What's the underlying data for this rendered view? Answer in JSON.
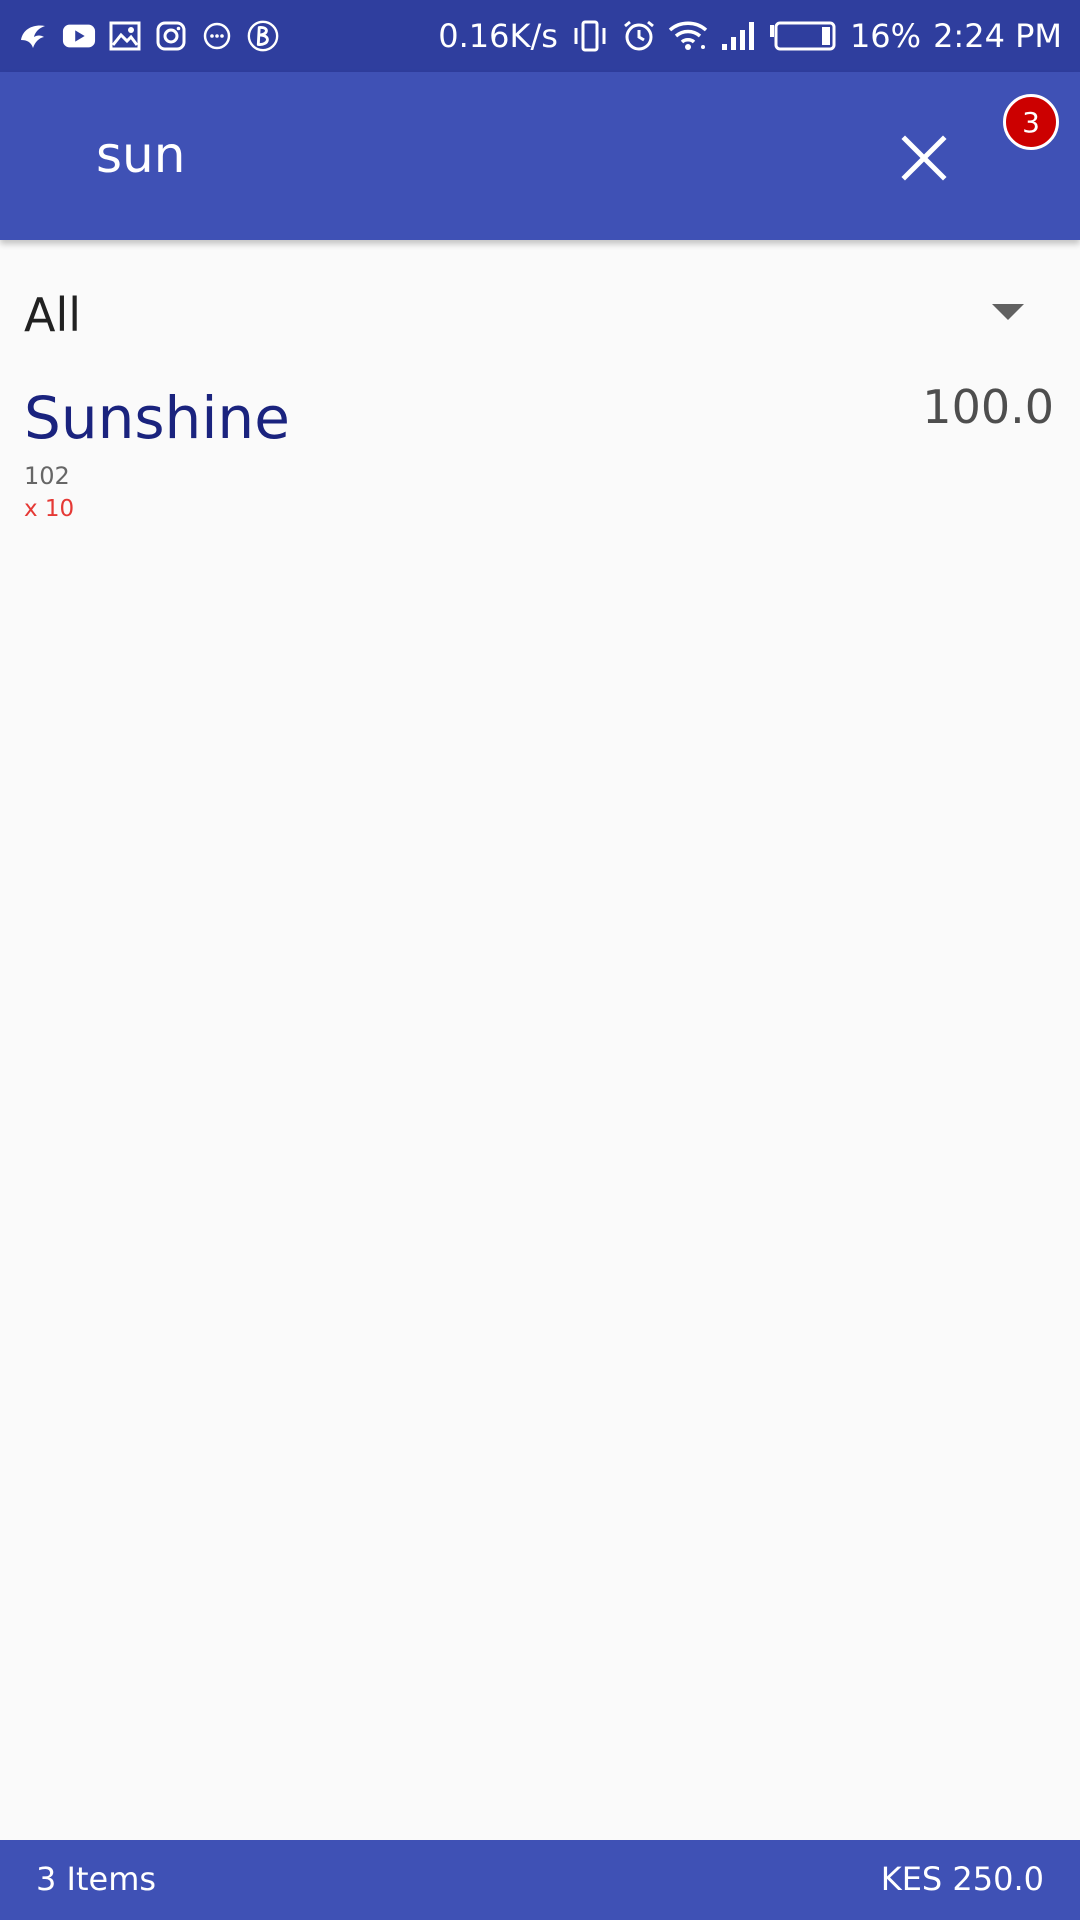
{
  "status_bar": {
    "network_speed": "0.16K/s",
    "battery_percent": "16%",
    "time": "2:24 PM",
    "left_icons": [
      "bird-app-icon",
      "youtube-icon",
      "gallery-icon",
      "instagram-icon",
      "chat-bubble-icon",
      "b-circle-icon"
    ],
    "right_icons": [
      "vibrate-icon",
      "alarm-icon",
      "wifi-icon",
      "signal-icon",
      "battery-icon"
    ]
  },
  "app_bar": {
    "search_query": "sun",
    "close_icon": "close-icon",
    "cart_count": "3",
    "colors": {
      "status_bar": "#2F3E9E",
      "primary": "#3F51B5",
      "badge": "#CC0000"
    }
  },
  "filter": {
    "selected_category": "All",
    "icon": "dropdown-arrow-icon"
  },
  "products": [
    {
      "name": "Sunshine",
      "price": "100.0",
      "code": "102",
      "quantity": "x 10"
    }
  ],
  "footer": {
    "items_label": "3 Items",
    "total": "KES 250.0"
  }
}
